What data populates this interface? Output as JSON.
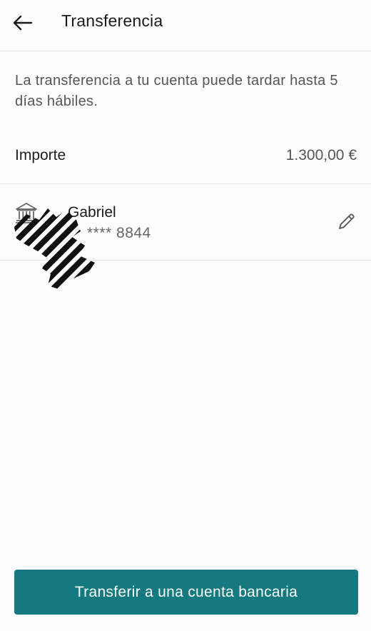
{
  "header": {
    "title": "Transferencia",
    "back_icon": "arrow-left-icon"
  },
  "notice": "La transferencia a tu cuenta puede tardar hasta 5 días hábiles.",
  "amount": {
    "label": "Importe",
    "value": "1.300,00 €"
  },
  "account": {
    "name": "Gabriel",
    "masked_number": "**** 8844",
    "bank_icon": "bank-icon",
    "edit_icon": "pencil-icon"
  },
  "cta": {
    "label": "Transferir a una cuenta bancaria",
    "color": "#157a7f"
  }
}
